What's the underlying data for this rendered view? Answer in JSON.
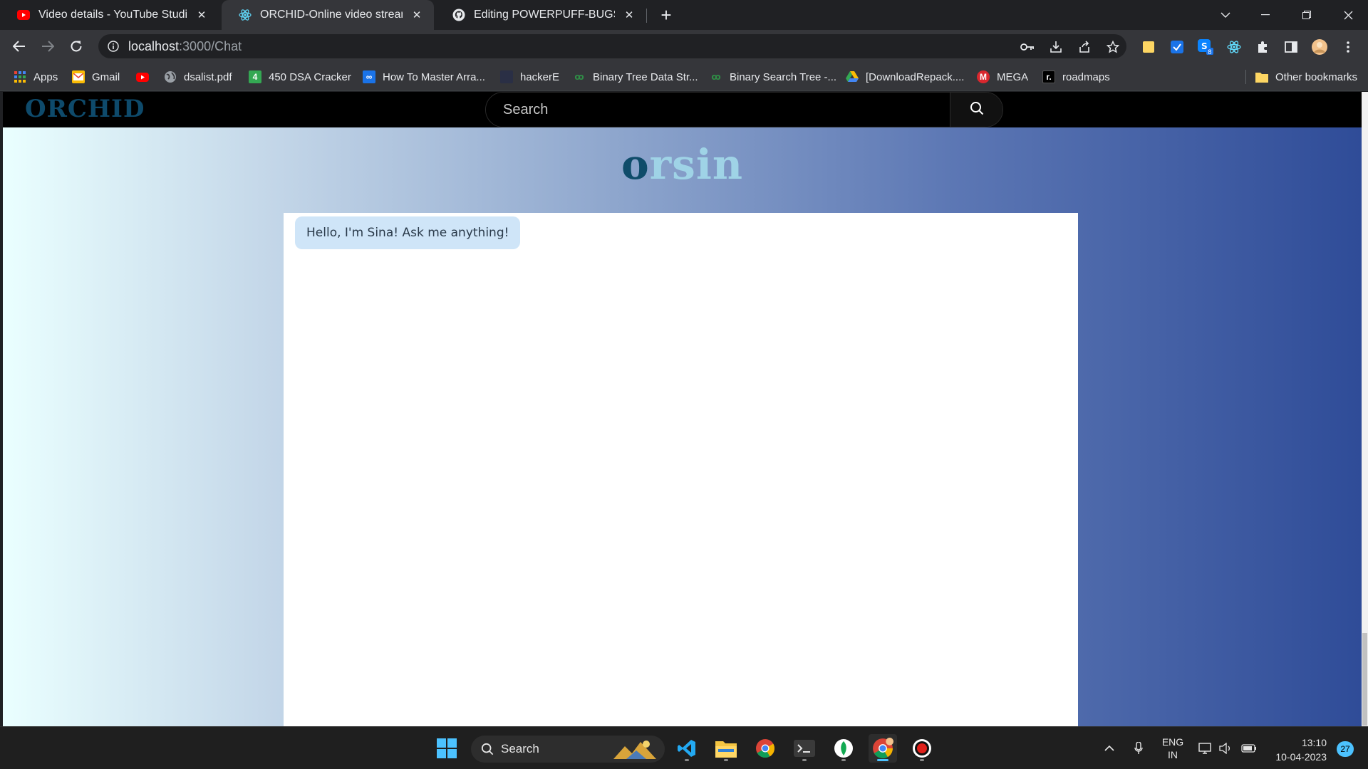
{
  "browser": {
    "tabs": [
      {
        "title": "Video details - YouTube Studio",
        "icon": "youtube-icon"
      },
      {
        "title": "ORCHID-Online video streaming",
        "icon": "react-icon",
        "active": true
      },
      {
        "title": "Editing POWERPUFF-BUGS-ORCHID",
        "icon": "github-icon"
      }
    ],
    "url_host": "localhost",
    "url_path": ":3000/Chat",
    "bookmarks": [
      {
        "label": "Apps",
        "icon": "apps-grid-icon"
      },
      {
        "label": "Gmail",
        "icon": "gmail-icon"
      },
      {
        "label": "",
        "icon": "youtube-icon"
      },
      {
        "label": "dsalist.pdf",
        "icon": "globe-icon"
      },
      {
        "label": "450 DSA Cracker",
        "icon": "sheet-4-icon"
      },
      {
        "label": "How To Master Arra...",
        "icon": "infinity-icon"
      },
      {
        "label": "hackerE",
        "icon": "hackere-icon"
      },
      {
        "label": "Binary Tree Data Str...",
        "icon": "gfg-icon"
      },
      {
        "label": "Binary Search Tree -...",
        "icon": "gfg-icon"
      },
      {
        "label": "[DownloadRepack....",
        "icon": "drive-icon"
      },
      {
        "label": "MEGA",
        "icon": "mega-icon"
      },
      {
        "label": "roadmaps",
        "icon": "roadmaps-icon"
      }
    ],
    "other_bookmarks": "Other bookmarks"
  },
  "app": {
    "brand": "ORCHID",
    "search_placeholder": "Search",
    "bot_title_first": "o",
    "bot_title_rest": "rsin",
    "messages": [
      {
        "text": "Hello, I'm Sina! Ask me anything!",
        "from": "bot"
      }
    ]
  },
  "taskbar": {
    "search_label": "Search",
    "lang_line1": "ENG",
    "lang_line2": "IN",
    "time": "13:10",
    "date": "10-04-2023",
    "notifications": "27"
  },
  "colors": {
    "brand": "#0e4a6b",
    "bot_title_accent": "#9fd3e6",
    "message_bubble": "#cfe5f8"
  }
}
